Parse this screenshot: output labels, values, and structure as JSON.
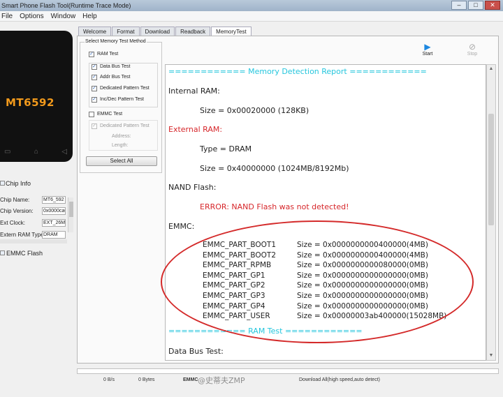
{
  "window": {
    "title": "Smart Phone Flash Tool(Runtime Trace Mode)",
    "min": "–",
    "max": "□",
    "close": "✕"
  },
  "menu": [
    "File",
    "Options",
    "Window",
    "Help"
  ],
  "phone": {
    "model": "MT6592",
    "keys": [
      "▭",
      "⌂",
      "◁"
    ]
  },
  "chip_info": {
    "header": "Chip Info",
    "rows": [
      {
        "label": "Chip Name:",
        "value": "MT6_592"
      },
      {
        "label": "Chip Version:",
        "value": "0x0000ca00"
      },
      {
        "label": "Ext Clock:",
        "value": "EXT_26M"
      },
      {
        "label": "Extern RAM Type:",
        "value": "DRAM"
      }
    ]
  },
  "emmc_flash_label": "EMMC Flash",
  "tabs": [
    "Welcome",
    "Format",
    "Download",
    "Readback",
    "MemoryTest"
  ],
  "method": {
    "title": "Select Memory Test Method",
    "ram_test": "RAM Test",
    "items": [
      "Data Bus Test",
      "Addr Bus Test",
      "Dedicated Pattern Test",
      "Inc/Dec Pattern Test"
    ],
    "emmc_test": "EMMC Test",
    "emmc_sub": "Dedicated Pattern Test",
    "address": "Address:",
    "length": "Length:",
    "select_all": "Select All"
  },
  "toolbar": {
    "start": "Start",
    "start_icon": "play-icon",
    "stop": "Stop",
    "stop_icon": "stop-icon"
  },
  "report": {
    "header": "============ Memory Detection Report ============",
    "internal_ram": "Internal RAM:",
    "internal_size": "Size = 0x00020000 (128KB)",
    "external_ram": "External RAM:",
    "type": "Type = DRAM",
    "ext_size": "Size = 0x40000000 (1024MB/8192Mb)",
    "nand": "NAND Flash:",
    "nand_error": "ERROR: NAND Flash was not detected!",
    "emmc": "EMMC:",
    "emmc_parts": [
      {
        "name": "EMMC_PART_BOOT1",
        "size": "Size = 0x0000000000400000(4MB)"
      },
      {
        "name": "EMMC_PART_BOOT2",
        "size": "Size = 0x0000000000400000(4MB)"
      },
      {
        "name": "EMMC_PART_RPMB",
        "size": "Size = 0x0000000000080000(0MB)"
      },
      {
        "name": "EMMC_PART_GP1",
        "size": "Size = 0x0000000000000000(0MB)"
      },
      {
        "name": "EMMC_PART_GP2",
        "size": "Size = 0x0000000000000000(0MB)"
      },
      {
        "name": "EMMC_PART_GP3",
        "size": "Size = 0x0000000000000000(0MB)"
      },
      {
        "name": "EMMC_PART_GP4",
        "size": "Size = 0x0000000000000000(0MB)"
      },
      {
        "name": "EMMC_PART_USER",
        "size": "Size = 0x00000003ab400000(15028MB)"
      }
    ],
    "ram_test_header": "============ RAM Test ============",
    "data_bus_test": "Data Bus Test:"
  },
  "status": {
    "speed": "0 B/s",
    "bytes": "0 Bytes",
    "storage": "EMMC",
    "mode": "Download All(high speed,auto detect)"
  },
  "watermark": "@史蒂夫ZMP",
  "colors": {
    "accent": "#25c6dd",
    "error": "#d6262a",
    "circle": "#d42a2a",
    "chip_text": "#f29a1c"
  }
}
